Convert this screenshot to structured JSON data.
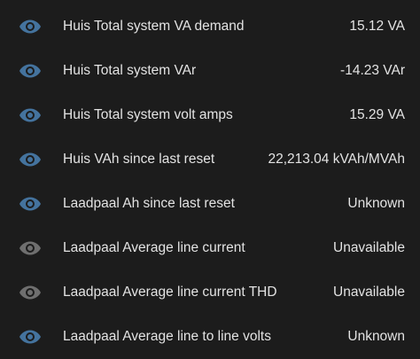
{
  "colors": {
    "background": "#1c1c1c",
    "text": "#e3e3e3",
    "icon_available": "#44739e",
    "icon_unavailable": "#6f6f6f"
  },
  "entities": [
    {
      "icon": "eye-icon",
      "name": "Huis Total system VA demand",
      "value": "15.12 VA",
      "available": true
    },
    {
      "icon": "eye-icon",
      "name": "Huis Total system VAr",
      "value": "-14.23 VAr",
      "available": true
    },
    {
      "icon": "eye-icon",
      "name": "Huis Total system volt amps",
      "value": "15.29 VA",
      "available": true
    },
    {
      "icon": "eye-icon",
      "name": "Huis VAh since last reset",
      "value": "22,213.04 kVAh/MVAh",
      "available": true
    },
    {
      "icon": "eye-icon",
      "name": "Laadpaal Ah since last reset",
      "value": "Unknown",
      "available": true
    },
    {
      "icon": "eye-icon",
      "name": "Laadpaal Average line current",
      "value": "Unavailable",
      "available": false
    },
    {
      "icon": "eye-icon",
      "name": "Laadpaal Average line current THD",
      "value": "Unavailable",
      "available": false
    },
    {
      "icon": "eye-icon",
      "name": "Laadpaal Average line to line volts",
      "value": "Unknown",
      "available": true
    }
  ]
}
